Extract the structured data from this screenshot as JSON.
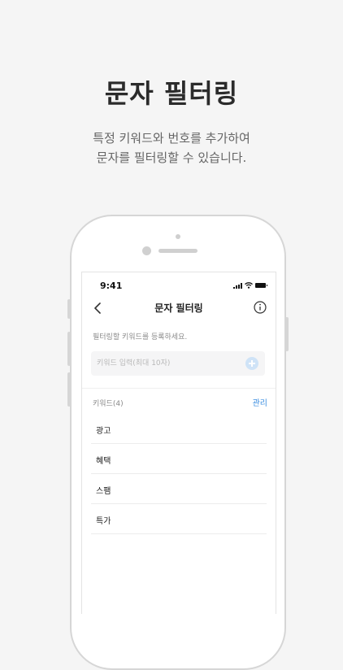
{
  "hero": {
    "title": "문자 필터링",
    "subtitle_line1": "특정 키워드와 번호를 추가하여",
    "subtitle_line2": "문자를 필터링할 수 있습니다."
  },
  "status_bar": {
    "time": "9:41"
  },
  "nav": {
    "title": "문자 필터링",
    "back_icon": "chevron-left-icon",
    "info_icon": "info-circle-icon"
  },
  "guide_text": "필터링할 키워드를 등록하세요.",
  "keyword_input": {
    "value": "",
    "placeholder": "키워드 입력(최대 10자)",
    "add_icon": "plus-circle-icon"
  },
  "keyword_list": {
    "header": "키워드(4)",
    "manage_label": "관리",
    "items": [
      {
        "label": "광고"
      },
      {
        "label": "혜택"
      },
      {
        "label": "스팸"
      },
      {
        "label": "특가"
      }
    ]
  },
  "colors": {
    "accent": "#3b8ee0",
    "add_button": "#cfe3f7",
    "background": "#f5f5f5"
  }
}
